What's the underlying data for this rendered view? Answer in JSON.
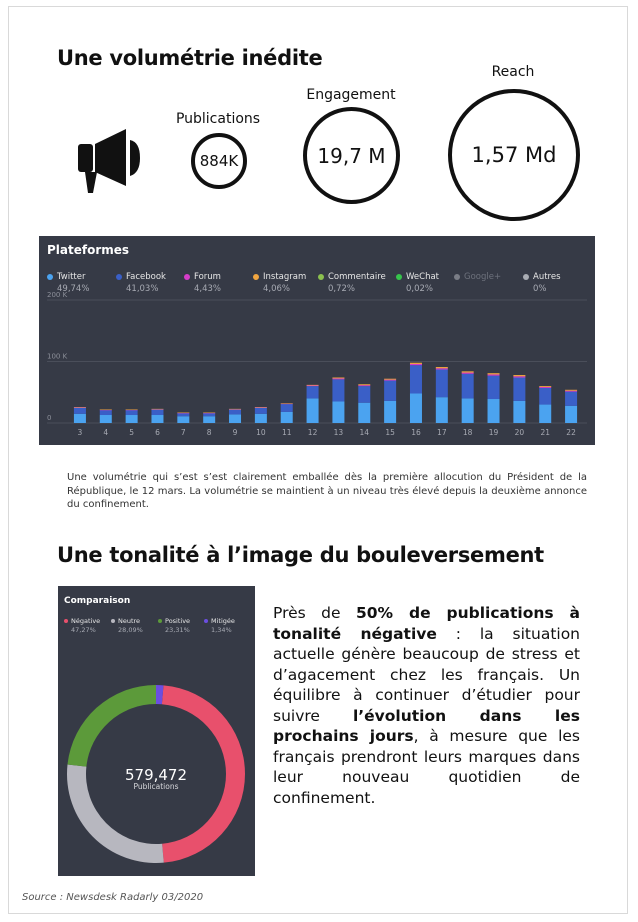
{
  "section1": {
    "title": "Une volumétrie inédite"
  },
  "kpis": [
    {
      "label": "Publications",
      "value": "884K"
    },
    {
      "label": "Engagement",
      "value": "19,7 M"
    },
    {
      "label": "Reach",
      "value": "1,57 Md"
    }
  ],
  "icons": {
    "kpi": "megaphone-icon"
  },
  "platforms_panel": {
    "title": "Plateformes",
    "legend": [
      {
        "name": "Twitter",
        "pct": "49,74%",
        "color": "#4ba3f0"
      },
      {
        "name": "Facebook",
        "pct": "41,03%",
        "color": "#3a5fc7"
      },
      {
        "name": "Forum",
        "pct": "4,43%",
        "color": "#d63dc9"
      },
      {
        "name": "Instagram",
        "pct": "4,06%",
        "color": "#f0a540"
      },
      {
        "name": "Commentaire",
        "pct": "0,72%",
        "color": "#8bc04e"
      },
      {
        "name": "WeChat",
        "pct": "0,02%",
        "color": "#36c44b"
      },
      {
        "name": "Google+",
        "pct": "",
        "color": "#7a7d86",
        "muted": true
      },
      {
        "name": "Autres",
        "pct": "0%",
        "color": "#a9acb3"
      }
    ]
  },
  "chart_data": {
    "type": "bar",
    "stacked": true,
    "categories": [
      "3",
      "4",
      "5",
      "6",
      "7",
      "8",
      "9",
      "10",
      "11",
      "12",
      "13",
      "14",
      "15",
      "16",
      "17",
      "18",
      "19",
      "20",
      "21",
      "22"
    ],
    "y_tick_labels": [
      "0",
      "100 K",
      "200 K"
    ],
    "ylim": [
      0,
      200000
    ],
    "grid": true,
    "series": [
      {
        "name": "Twitter",
        "color": "#4ba3f0",
        "values": [
          15000,
          13000,
          13000,
          13000,
          11000,
          11000,
          14000,
          15000,
          18000,
          40000,
          35000,
          33000,
          36000,
          48000,
          42000,
          40000,
          39000,
          36000,
          30000,
          28000
        ]
      },
      {
        "name": "Facebook",
        "color": "#3a5fc7",
        "values": [
          10000,
          8000,
          8000,
          9000,
          5000,
          5000,
          8000,
          10000,
          13000,
          20000,
          36000,
          27000,
          33000,
          46000,
          45000,
          40000,
          38000,
          38000,
          27000,
          23000
        ]
      },
      {
        "name": "Forum",
        "color": "#d63dc9",
        "values": [
          500,
          500,
          500,
          500,
          500,
          500,
          500,
          500,
          500,
          1000,
          1500,
          1500,
          1500,
          2000,
          2000,
          2000,
          2000,
          2000,
          1500,
          1500
        ]
      },
      {
        "name": "Instagram",
        "color": "#f0a540",
        "values": [
          500,
          500,
          500,
          500,
          500,
          500,
          500,
          500,
          500,
          1000,
          1500,
          1500,
          1500,
          2000,
          2000,
          2000,
          2000,
          2000,
          1500,
          1500
        ]
      }
    ]
  },
  "caption": "Une volumétrie qui s’est s’est clairement emballée dès la première allocution du Président de la République, le 12 mars. La volumétrie se maintient à un niveau très élevé depuis la deuxième annonce du confinement.",
  "section2": {
    "title": "Une tonalité à l’image du bouleversement"
  },
  "comparison_panel": {
    "title": "Comparaison",
    "legend": [
      {
        "name": "Négative",
        "pct": "47,27%",
        "color": "#e8506c"
      },
      {
        "name": "Neutre",
        "pct": "28,09%",
        "color": "#b7b7bf"
      },
      {
        "name": "Positive",
        "pct": "23,31%",
        "color": "#5c9a3a"
      },
      {
        "name": "Mitigée",
        "pct": "1,34%",
        "color": "#6b4ee0"
      }
    ],
    "center_value": "579,472",
    "center_label": "Publications"
  },
  "tonality_chart": {
    "type": "pie",
    "labels": [
      "Négative",
      "Neutre",
      "Positive",
      "Mitigée"
    ],
    "values": [
      47.27,
      28.09,
      23.31,
      1.34
    ],
    "colors": [
      "#e8506c",
      "#b7b7bf",
      "#5c9a3a",
      "#6b4ee0"
    ]
  },
  "body": {
    "t1": "Près de ",
    "b1": "50% de publications à tonalité négative",
    "t2": " : la situation actuelle génère beaucoup de stress et d’agacement chez les français. Un équilibre à continuer d’étudier pour suivre ",
    "b2": "l’évolution dans les prochains jours",
    "t3": ", à mesure que les français prendront leurs marques dans leur nouveau quotidien de confinement."
  },
  "source": "Source : Newsdesk Radarly 03/2020"
}
